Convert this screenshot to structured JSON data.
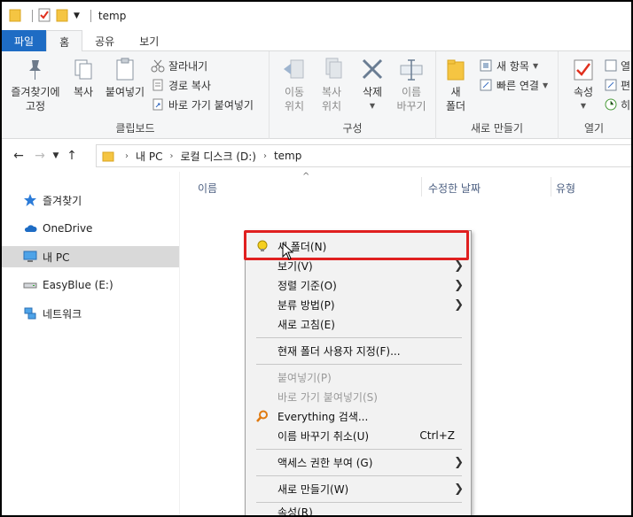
{
  "window": {
    "title": "temp"
  },
  "ribbon": {
    "tabs": [
      "파일",
      "홈",
      "공유",
      "보기"
    ],
    "clipboard": {
      "pin": "즐겨찾기에\n고정",
      "copy": "복사",
      "paste": "붙여넣기",
      "cut": "잘라내기",
      "copy_path": "경로 복사",
      "paste_shortcut": "바로 가기 붙여넣기",
      "label": "클립보드"
    },
    "organize": {
      "move_to": "이동\n위치",
      "copy_to": "복사\n위치",
      "delete": "삭제",
      "rename": "이름\n바꾸기",
      "label": "구성"
    },
    "new": {
      "new_folder": "새\n폴더",
      "new_item": "새 항목",
      "easy_access": "빠른 연결",
      "label": "새로 만들기"
    },
    "open": {
      "properties": "속성",
      "open_short": "열",
      "edit_short": "편",
      "history_short": "히",
      "label": "열기"
    }
  },
  "address": {
    "crumbs": [
      "내 PC",
      "로컬 디스크 (D:)",
      "temp"
    ]
  },
  "sidebar": {
    "items": [
      {
        "label": "즐겨찾기"
      },
      {
        "label": "OneDrive"
      },
      {
        "label": "내 PC"
      },
      {
        "label": "EasyBlue (E:)"
      },
      {
        "label": "네트워크"
      }
    ]
  },
  "columns": {
    "name": "이름",
    "date": "수정한 날짜",
    "type": "유형"
  },
  "context_menu": {
    "items": [
      {
        "label": "새 폴더(N)"
      },
      {
        "label": "보기(V)"
      },
      {
        "label": "정렬 기준(O)"
      },
      {
        "label": "분류 방법(P)"
      },
      {
        "label": "새로 고침(E)"
      },
      {
        "label": "현재 폴더 사용자 지정(F)..."
      },
      {
        "label": "붙여넣기(P)"
      },
      {
        "label": "바로 가기 붙여넣기(S)"
      },
      {
        "label": "Everything 검색..."
      },
      {
        "label": "이름 바꾸기 취소(U)",
        "shortcut": "Ctrl+Z"
      },
      {
        "label": "액세스 권한 부여 (G)"
      },
      {
        "label": "새로 만들기(W)"
      },
      {
        "label": "속성(R)"
      }
    ]
  },
  "colors": {
    "accent": "#1e6cc4",
    "highlight": "#e02020",
    "folder": "#f5c542"
  }
}
